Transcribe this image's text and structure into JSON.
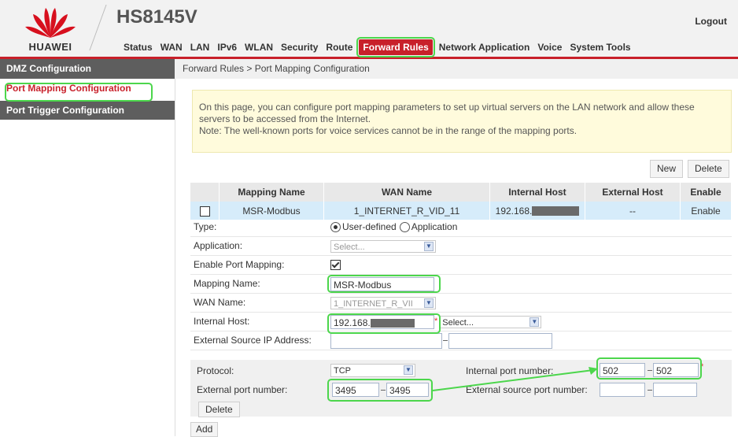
{
  "header": {
    "brand": "HUAWEI",
    "model": "HS8145V",
    "logout": "Logout",
    "nav": [
      "Status",
      "WAN",
      "LAN",
      "IPv6",
      "WLAN",
      "Security",
      "Route",
      "Forward Rules",
      "Network Application",
      "Voice",
      "System Tools"
    ],
    "active_nav": "Forward Rules",
    "accent": "#c8202a"
  },
  "sidebar": {
    "items": [
      "DMZ Configuration",
      "Port Mapping Configuration",
      "Port Trigger Configuration"
    ]
  },
  "breadcrumb": "Forward Rules > Port Mapping Configuration",
  "note": {
    "line1": "On this page, you can configure port mapping parameters to set up virtual servers on the LAN network and allow these",
    "line2": "servers to be accessed from the Internet.",
    "line3": "Note: The well-known ports for voice services cannot be in the range of the mapping ports."
  },
  "buttons": {
    "new": "New",
    "delete": "Delete",
    "delete_row": "Delete",
    "add": "Add"
  },
  "table": {
    "headers": [
      "Mapping Name",
      "WAN Name",
      "Internal Host",
      "External Host",
      "Enable"
    ],
    "row": {
      "mapping_name": "MSR-Modbus",
      "wan_name": "1_INTERNET_R_VID_11",
      "internal_host": "192.168.",
      "external_host": "--",
      "enable": "Enable"
    }
  },
  "form": {
    "type_label": "Type:",
    "type_opt1": "User-defined",
    "type_opt2": "Application",
    "application_label": "Application:",
    "application_value": "Select...",
    "enable_label": "Enable Port Mapping:",
    "mapping_name_label": "Mapping Name:",
    "mapping_name_value": "MSR-Modbus",
    "wan_name_label": "WAN Name:",
    "wan_name_value": "1_INTERNET_R_VII",
    "internal_host_label": "Internal Host:",
    "internal_host_value": "192.168.",
    "internal_host_select": "Select...",
    "ext_src_ip_label": "External Source IP Address:"
  },
  "protocol": {
    "protocol_label": "Protocol:",
    "protocol_value": "TCP",
    "int_port_label": "Internal port number:",
    "int_port_start": "502",
    "int_port_end": "502",
    "ext_port_label": "External port number:",
    "ext_port_start": "3495",
    "ext_port_end": "3495",
    "ext_src_port_label": "External source port number:"
  },
  "required_mark": "*"
}
